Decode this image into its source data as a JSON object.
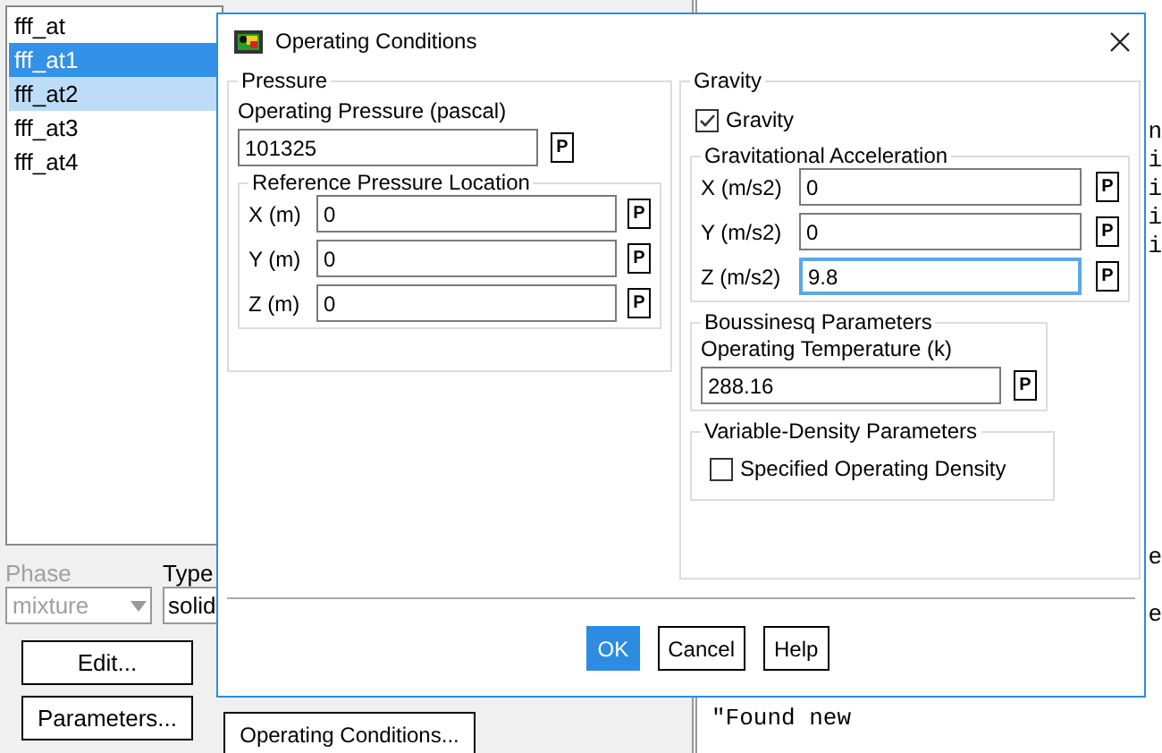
{
  "background": {
    "zones": [
      {
        "label": "fff_at",
        "selected": false,
        "hover": false
      },
      {
        "label": "fff_at1",
        "selected": true,
        "hover": false
      },
      {
        "label": "fff_at2",
        "selected": false,
        "hover": true
      },
      {
        "label": "fff_at3",
        "selected": false,
        "hover": false
      },
      {
        "label": "fff_at4",
        "selected": false,
        "hover": false
      }
    ],
    "phase": {
      "label": "Phase",
      "value": "mixture",
      "disabled": true
    },
    "type": {
      "label": "Type",
      "value": "solid"
    },
    "buttons": [
      "Edit...",
      "Parameters..."
    ],
    "operating_conditions_button": "Operating Conditions...",
    "console_upper": [
      "n",
      "i",
      "i",
      "i",
      "i"
    ],
    "console_lower": [
      "e",
      "e"
    ],
    "console_message": "\"Found new"
  },
  "dialog": {
    "title": "Operating Conditions",
    "pressure": {
      "title": "Pressure",
      "operating_label": "Operating Pressure (pascal)",
      "operating_value": "101325",
      "param_button": "P",
      "reference": {
        "title": "Reference Pressure Location",
        "fields": [
          {
            "label": "X (m)",
            "value": "0",
            "focused": false,
            "param_button": "P"
          },
          {
            "label": "Y (m)",
            "value": "0",
            "focused": false,
            "param_button": "P"
          },
          {
            "label": "Z (m)",
            "value": "0",
            "focused": false,
            "param_button": "P"
          }
        ]
      }
    },
    "gravity": {
      "title": "Gravity",
      "checkbox": {
        "label": "Gravity",
        "checked": true
      },
      "acceleration": {
        "title": "Gravitational Acceleration",
        "fields": [
          {
            "label": "X (m/s2)",
            "value": "0",
            "focused": false,
            "param_button": "P"
          },
          {
            "label": "Y (m/s2)",
            "value": "0",
            "focused": false,
            "param_button": "P"
          },
          {
            "label": "Z (m/s2)",
            "value": "9.8",
            "focused": true,
            "param_button": "P"
          }
        ]
      },
      "boussinesq": {
        "title": "Boussinesq Parameters",
        "label": "Operating Temperature (k)",
        "value": "288.16",
        "param_button": "P"
      },
      "variable_density": {
        "title": "Variable-Density Parameters",
        "checkbox": {
          "label": "Specified Operating Density",
          "checked": false
        }
      }
    },
    "buttons": [
      {
        "label": "OK",
        "default": true
      },
      {
        "label": "Cancel",
        "default": false
      },
      {
        "label": "Help",
        "default": false
      }
    ]
  }
}
